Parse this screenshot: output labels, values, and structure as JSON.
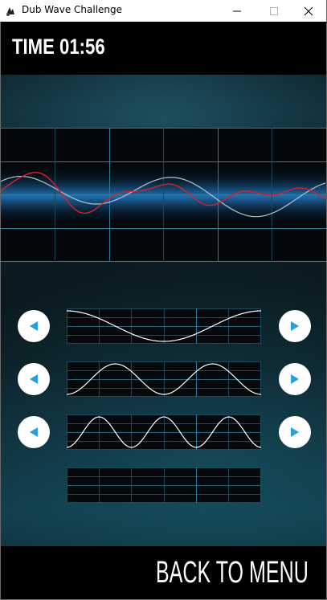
{
  "window": {
    "title": "Dub Wave Challenge",
    "controls": [
      "minimize",
      "maximize",
      "close"
    ]
  },
  "hud": {
    "timer_label": "TIME",
    "timer_value": "01:56"
  },
  "target_display": {
    "target_color": "#e01e26",
    "current_color": "#b8c4c8",
    "glow_color": "#1e6aa8"
  },
  "controls": {
    "rows": [
      {
        "name": "wave-row-1",
        "cycles": 1
      },
      {
        "name": "wave-row-2",
        "cycles": 2
      },
      {
        "name": "wave-row-3",
        "cycles": 3
      },
      {
        "name": "wave-row-4",
        "cycles": 0
      }
    ],
    "arrow_color": "#2a9fd8"
  },
  "footer": {
    "back_label": "BACK TO MENU"
  }
}
